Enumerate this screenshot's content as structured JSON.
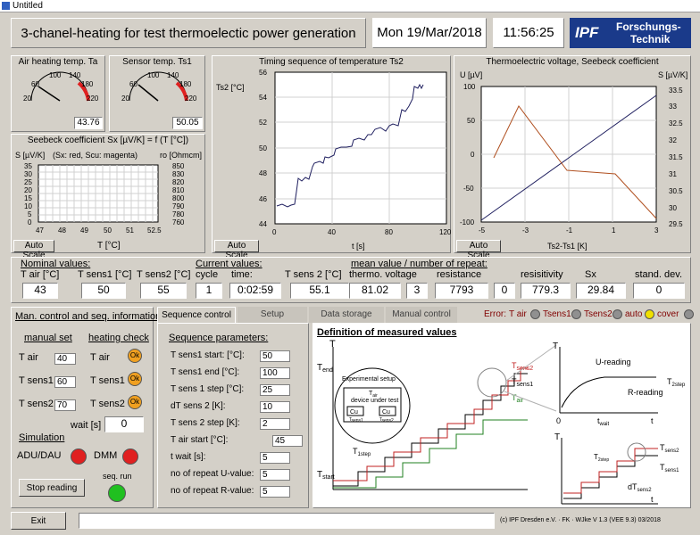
{
  "window": {
    "title": "Untitled"
  },
  "header": {
    "title": "3-chanel-heating for test thermoelectic power generation",
    "date": "Mon 19/Mar/2018",
    "time": "11:56:25",
    "logo_line1": "Forschungs-",
    "logo_line2": "Technik",
    "logo_mark": "IPF"
  },
  "gauges": {
    "air": {
      "title": "Air heating temp. Ta",
      "value": "43.76",
      "ticks": [
        "20",
        "60",
        "100",
        "140",
        "180",
        "220"
      ],
      "level": 0.13
    },
    "sensor": {
      "title": "Sensor temp. Ts1",
      "value": "50.05",
      "ticks": [
        "20",
        "60",
        "100",
        "140",
        "180",
        "220"
      ],
      "level": 0.15
    }
  },
  "seebeck": {
    "title": "Seebeck coefficient Sx [µV/K] = f (T [°C])",
    "ylabel": "S  [µV/K]",
    "legend": "(Sx: red, Scu: magenta)",
    "rlabel": "ro [Ohmcm]",
    "yticks": [
      "35",
      "30",
      "25",
      "20",
      "15",
      "10",
      "5",
      "0"
    ],
    "rticks": [
      "850",
      "830",
      "820",
      "810",
      "800",
      "790",
      "780",
      "760"
    ],
    "xticks": [
      "47",
      "48",
      "49",
      "50",
      "51",
      "52.5"
    ],
    "xlabel": "T [°C]",
    "autoscale": "Auto Scale"
  },
  "timing": {
    "title": "Timing sequence of temperature Ts2",
    "ylabel": "Ts2 [°C]",
    "xlabel": "t [s]",
    "autoscale": "Auto Scale",
    "yticks": [
      "56",
      "54",
      "52",
      "50",
      "48",
      "46",
      "44"
    ],
    "xticks": [
      "0",
      "40",
      "80",
      "120"
    ]
  },
  "thermo": {
    "title": "Thermoelectric voltage, Seebeck coefficient",
    "ylabel": "U [µV]",
    "rlabel": "S [µV/K]",
    "xlabel": "Ts2-Ts1 [K]",
    "autoscale": "Auto Scale",
    "yticks": [
      "100",
      "50",
      "0",
      "-50",
      "-100"
    ],
    "rticks": [
      "33.5",
      "33",
      "32.5",
      "32",
      "31.5",
      "31",
      "30.5",
      "30",
      "29.5"
    ],
    "xticks": [
      "-5",
      "-3",
      "-1",
      "1",
      "3"
    ]
  },
  "nominal": {
    "heading": "Nominal values:",
    "h_tair": "T air  [°C]",
    "h_ts1": "T sens1 [°C]",
    "h_ts2": "T sens2 [°C]",
    "tair": "43",
    "ts1": "50",
    "ts2": "55"
  },
  "current": {
    "heading": "Current values:",
    "h_cycle": "cycle",
    "h_time": "time:",
    "h_ts2": "T sens 2 [°C]",
    "cycle": "1",
    "time": "0:02:59",
    "ts2": "55.1"
  },
  "mean": {
    "heading": "mean value / number of repeat:",
    "h_volt": "thermo. voltage",
    "h_res": "resistance",
    "h_resv": "resisitivity",
    "h_sx": "Sx",
    "h_std": "stand. dev.",
    "volt": "81.02",
    "volt_n": "3",
    "res": "7793",
    "res_n": "0",
    "resv": "779.3",
    "sx": "29.84",
    "std": "0"
  },
  "manual": {
    "heading": "Man. control and seq. information",
    "set_heading": "manual set",
    "check_heading": "heating check",
    "rows": [
      {
        "label": "T air",
        "value": "40",
        "check": "T air"
      },
      {
        "label": "T sens1",
        "value": "60",
        "check": "T sens1"
      },
      {
        "label": "T sens2",
        "value": "70",
        "check": "T sens2"
      }
    ],
    "ok": "Ok",
    "wait_label": "wait [s]",
    "wait": "0",
    "sim_heading": "Simulation",
    "adu": "ADU/DAU",
    "dmm": "DMM",
    "stop": "Stop reading",
    "seqrun": "seq. run"
  },
  "tabs": [
    "Sequence control",
    "Setup",
    "Data storage",
    "Manual control"
  ],
  "errors": {
    "label": "Error:",
    "items": [
      "T air",
      "Tsens1",
      "Tsens2",
      "auto",
      "cover"
    ]
  },
  "seq": {
    "heading": "Sequence parameters:",
    "rows": [
      {
        "label": "T sens1 start: [°C]:",
        "value": "50"
      },
      {
        "label": "T sens1 end [°C]:",
        "value": "100"
      },
      {
        "label": "T sens 1 step [°C]:",
        "value": "25"
      },
      {
        "label": "dT sens 2 [K]:",
        "value": "10"
      },
      {
        "label": "T sens 2 step [K]:",
        "value": "2"
      },
      {
        "label": "T air start [°C]:",
        "value": "45"
      },
      {
        "label": "t wait [s]:",
        "value": "5"
      },
      {
        "label": "no of repeat U-value:",
        "value": "5"
      },
      {
        "label": "no of repeat R-value:",
        "value": "5"
      }
    ]
  },
  "definition": {
    "heading": "Definition of measured values",
    "T": "T",
    "tend": "T",
    "tend_sub": "end",
    "tstart": "T",
    "tstart_sub": "start",
    "tsens2": "T",
    "tsens2_sub": "sens2",
    "tsens1": "T",
    "tsens1_sub": "sens1",
    "tair": "T",
    "tair_sub": "air",
    "exp": "Experimental setup",
    "dut1": "T",
    "dut1_sub": "air",
    "dut2": "device under test",
    "cu": "Cu",
    "ts1": "T",
    "ts1_sub": "sens1",
    "ts2": "T",
    "ts2_sub": "sens2",
    "t1step": "T",
    "t1step_sub": "1step",
    "ureading": "U-reading",
    "rreading": "R-reading",
    "t2step": "T",
    "t2step_sub": "2step",
    "zero": "0",
    "twait": "t",
    "twait_sub": "wait",
    "t": "t",
    "t2stepb": "T",
    "t2stepb_sub": "2step",
    "dt": "dT",
    "dt_sub": "sens2"
  },
  "footer": {
    "exit": "Exit",
    "copyright": "(c)  IPF Dresden e.V.  ·  FK  ·  WJke    V 1.3 (VEE 9.3)   03/2018"
  },
  "colors": {
    "red_led": "#e02020",
    "green_led": "#20c020",
    "orange_led": "#f0a020",
    "yellow_led": "#f0e000",
    "grey_led": "#909090"
  }
}
